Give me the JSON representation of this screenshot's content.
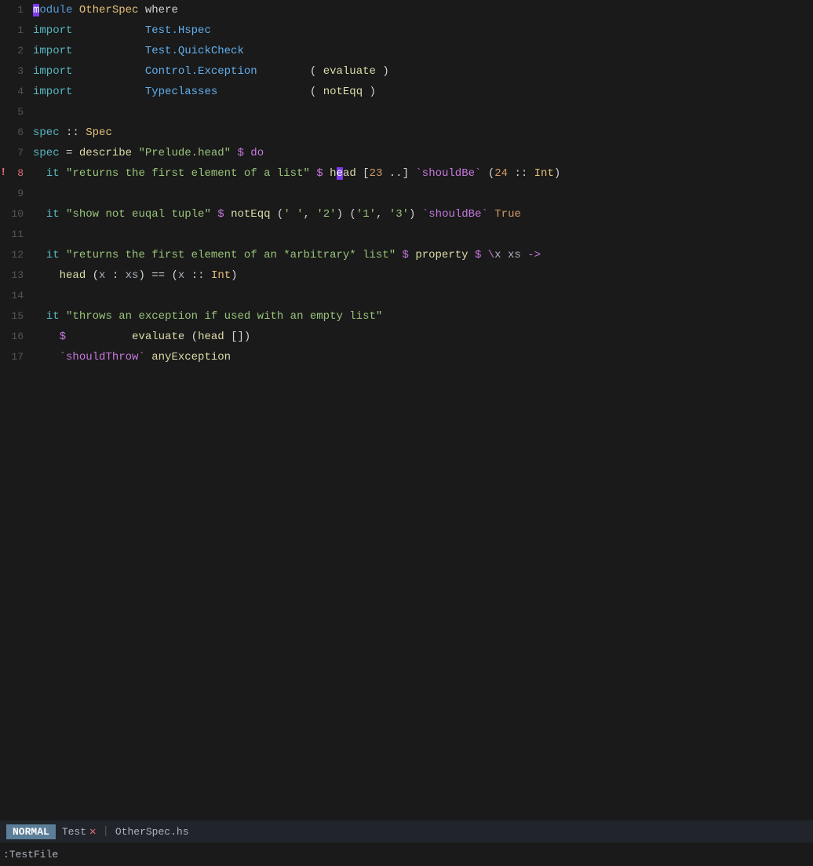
{
  "editor": {
    "title": "OtherSpec.hs",
    "mode": "NORMAL",
    "tab_name": "Test",
    "filename": "OtherSpec.hs"
  },
  "statusbar": {
    "mode": "NORMAL",
    "tab": "Test",
    "separator": "|",
    "file": "OtherSpec.hs"
  },
  "commandline": {
    "text": ":TestFile"
  },
  "lines": [
    {
      "number": "1",
      "error": false,
      "has_error_bang": false
    },
    {
      "number": "1",
      "error": false,
      "has_error_bang": false
    },
    {
      "number": "2",
      "error": false
    },
    {
      "number": "3",
      "error": false
    },
    {
      "number": "4",
      "error": false
    },
    {
      "number": "5",
      "error": false
    },
    {
      "number": "6",
      "error": false
    },
    {
      "number": "7",
      "error": false
    },
    {
      "number": "8",
      "error": true,
      "has_error_bang": true
    },
    {
      "number": "9",
      "error": false
    },
    {
      "number": "10",
      "error": false
    },
    {
      "number": "11",
      "error": false
    },
    {
      "number": "12",
      "error": false
    },
    {
      "number": "13",
      "error": false
    },
    {
      "number": "14",
      "error": false
    },
    {
      "number": "15",
      "error": false
    },
    {
      "number": "16",
      "error": false
    },
    {
      "number": "17",
      "error": false
    }
  ]
}
